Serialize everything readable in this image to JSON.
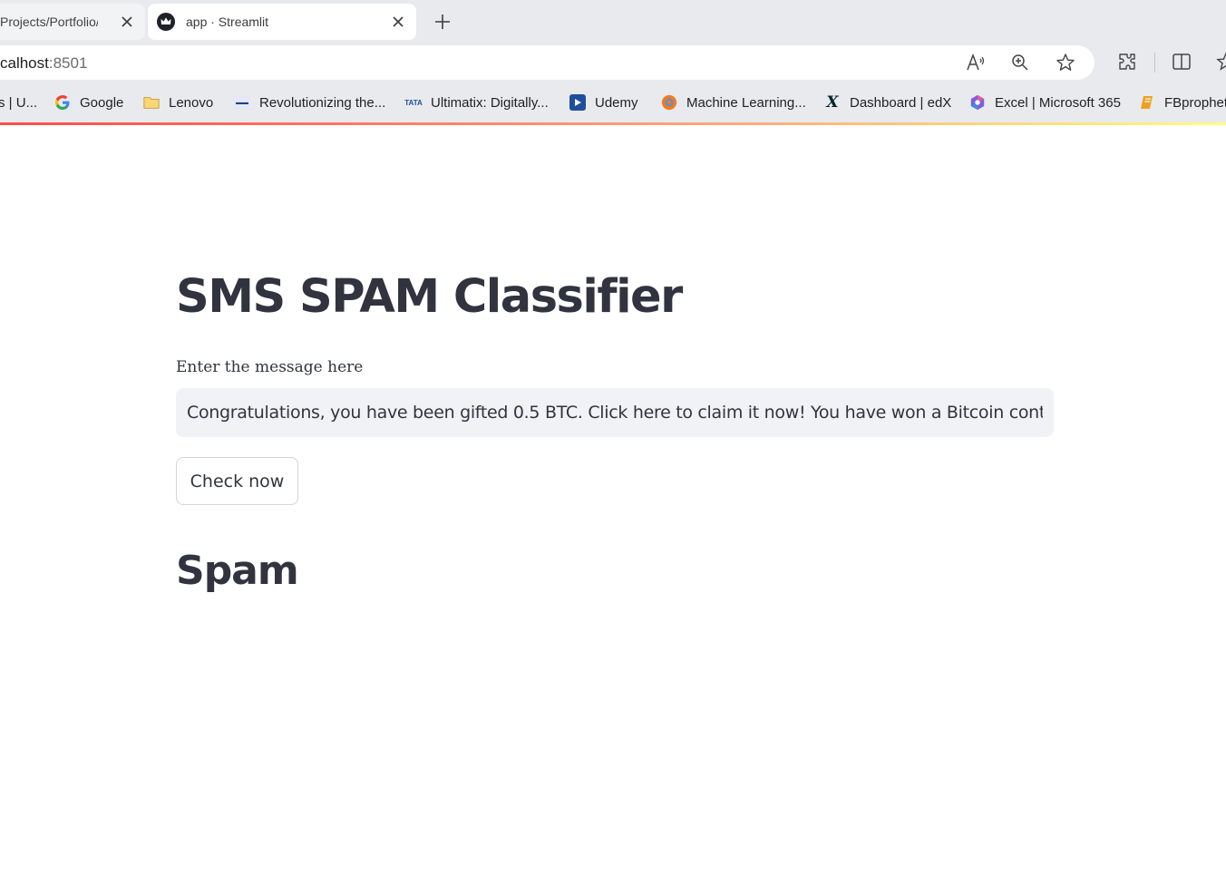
{
  "browser": {
    "tabs": [
      {
        "title": "Projects/Portfolio/S",
        "active": false
      },
      {
        "title": "app · Streamlit",
        "active": true
      }
    ],
    "address": {
      "host": "calhost",
      "port": ":8501"
    },
    "toolbar_icons": [
      "read-aloud-icon",
      "zoom-icon",
      "favorite-star-icon",
      "extensions-icon",
      "split-screen-icon",
      "favorites-icon"
    ],
    "bookmarks": [
      {
        "label": "s | U...",
        "icon": "partial-icon"
      },
      {
        "label": "Google",
        "icon": "google-icon",
        "color": "#4285f4"
      },
      {
        "label": "Lenovo",
        "icon": "folder-icon",
        "color": "#f4c542"
      },
      {
        "label": "Revolutionizing the...",
        "icon": "site-icon"
      },
      {
        "label": "Ultimatix: Digitally...",
        "icon": "tata-icon"
      },
      {
        "label": "Udemy",
        "icon": "udemy-icon"
      },
      {
        "label": "Machine Learning...",
        "icon": "ml-icon",
        "color": "#f07b20"
      },
      {
        "label": "Dashboard | edX",
        "icon": "edx-icon"
      },
      {
        "label": "Excel | Microsoft 365",
        "icon": "m365-icon"
      },
      {
        "label": "FBprophet",
        "icon": "fbprophet-icon",
        "color": "#f0a020"
      }
    ]
  },
  "app": {
    "title": "SMS SPAM Classifier",
    "input_label": "Enter the message here",
    "input_value": "Congratulations, you have been gifted 0.5 BTC. Click here to claim it now! You have won a Bitcoin contes",
    "button_label": "Check now",
    "result": "Spam"
  },
  "colors": {
    "text": "#31333f",
    "input_bg": "#f0f2f6",
    "accent": "#ff4b4b"
  }
}
